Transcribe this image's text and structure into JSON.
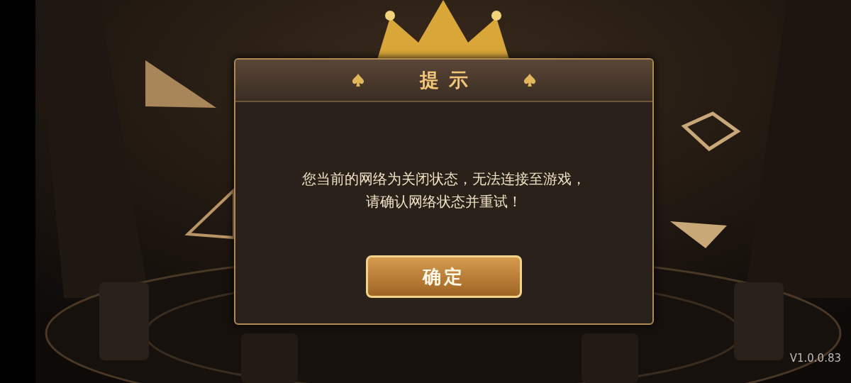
{
  "dialog": {
    "title": "提示",
    "message": "您当前的网络为关闭状态，无法连接至游戏，请确认网络状态并重试！",
    "button": "确定"
  },
  "version": "V1.0.0.83"
}
